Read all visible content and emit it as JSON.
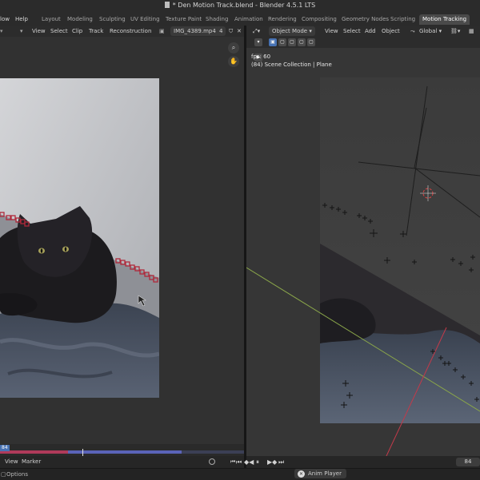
{
  "window": {
    "title": "* Den Motion Track.blend - Blender 4.5.1 LTS"
  },
  "menubar": {
    "items": [
      "low",
      "Help"
    ],
    "workspaces": [
      "Layout",
      "Modeling",
      "Sculpting",
      "UV Editing",
      "Texture Paint",
      "Shading",
      "Animation",
      "Rendering",
      "Compositing",
      "Geometry Nodes",
      "Scripting",
      "Motion Tracking"
    ],
    "active_workspace": "Motion Tracking"
  },
  "clip_editor": {
    "header": {
      "menus": [
        "View",
        "Select",
        "Clip",
        "Track",
        "Reconstruction"
      ],
      "clip_name": "IMG_4389.mp4",
      "users": "4"
    },
    "frame_badge": "84",
    "footer": {
      "menus": [
        "View",
        "Marker"
      ]
    }
  },
  "viewport": {
    "header": {
      "mode": "Object Mode",
      "menus": [
        "View",
        "Select",
        "Add",
        "Object"
      ],
      "orientation": "Global"
    },
    "overlay": {
      "fps": "fps: 60",
      "collection": "(84) Scene Collection | Plane"
    }
  },
  "timeline": {
    "current_frame": "84"
  },
  "status": {
    "options": "Options",
    "anim_player": "Anim Player"
  },
  "colors": {
    "accent": "#4772b3",
    "active_tab": "#4a4a4a",
    "marker_red": "#c03030",
    "axis_red": "#c23a4a",
    "axis_green": "#8aa64a"
  },
  "icons": [
    "document-icon",
    "zoom-icon",
    "hand-pan-icon",
    "play-icon",
    "jump-start-icon",
    "jump-end-icon",
    "prev-keyframe-icon",
    "next-keyframe-icon",
    "pause-icon",
    "close-icon",
    "record-icon",
    "fake-user-shield-icon",
    "global-orientation-icon",
    "link-icon",
    "select-box-icon"
  ]
}
